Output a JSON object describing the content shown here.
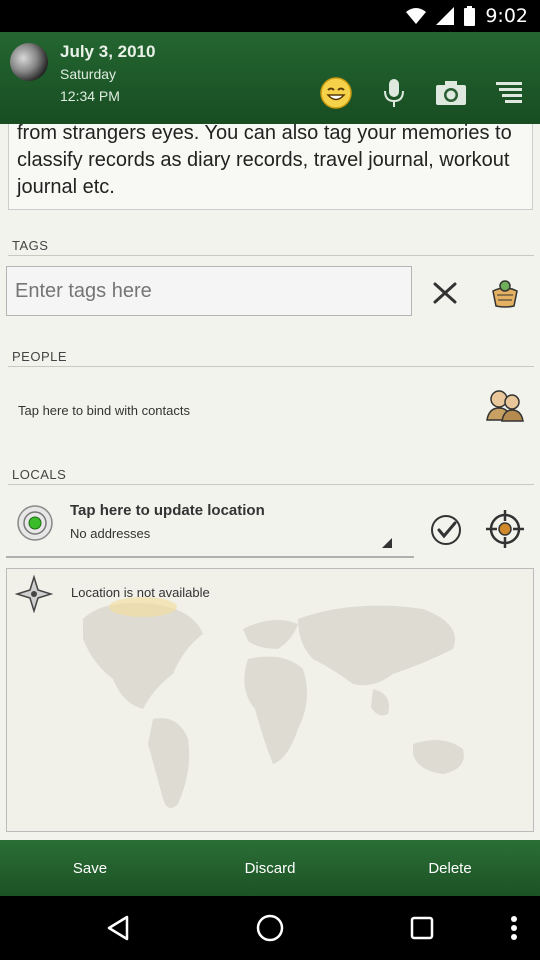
{
  "status_bar": {
    "time": "9:02"
  },
  "header": {
    "date": "July 3, 2010",
    "day": "Saturday",
    "time": "12:34 PM",
    "icons": [
      "smiley-icon",
      "microphone-icon",
      "camera-icon",
      "menu-icon"
    ]
  },
  "entry": {
    "body_text": "from strangers eyes. You can also tag your memories to classify records as diary records, travel journal, workout journal etc."
  },
  "tags": {
    "section_label": "TAGS",
    "input_placeholder": "Enter tags here"
  },
  "people": {
    "section_label": "PEOPLE",
    "bind_text": "Tap here to bind with contacts"
  },
  "locals": {
    "section_label": "LOCALS",
    "update_title": "Tap here to update location",
    "addresses": "No addresses",
    "location_status": "Location is not available"
  },
  "bottom_bar": {
    "save": "Save",
    "discard": "Discard",
    "delete": "Delete"
  },
  "colors": {
    "header_green": "#1f5a2a",
    "content_bg": "#f3f3ee"
  }
}
